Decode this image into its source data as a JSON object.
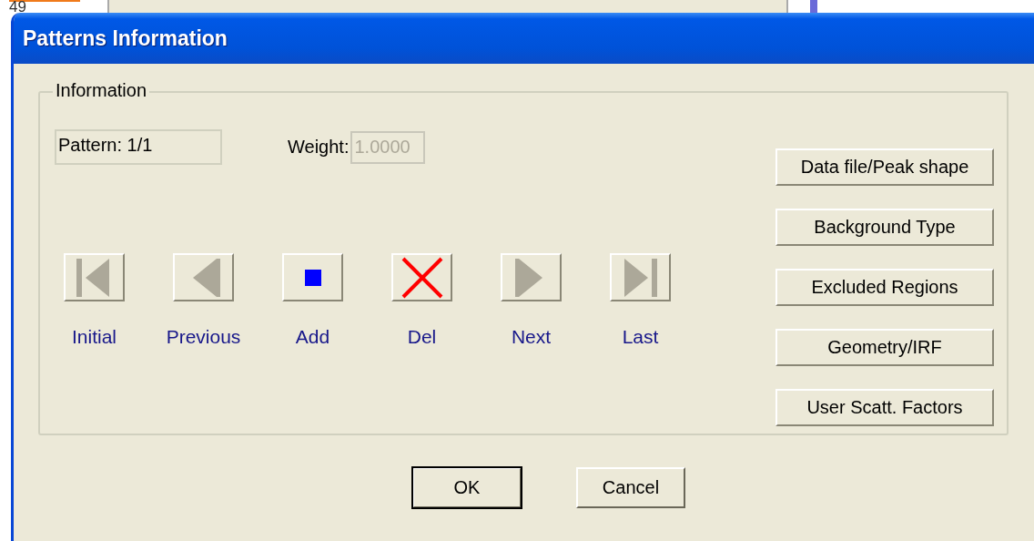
{
  "background": {
    "text": "49"
  },
  "window": {
    "title": "Patterns Information"
  },
  "group": {
    "title": "Information",
    "pattern": {
      "text": "Pattern: 1/1"
    },
    "weight": {
      "label": "Weight:",
      "value": "1.0000",
      "disabled": true
    },
    "nav": [
      {
        "kind": "first",
        "label": "Initial"
      },
      {
        "kind": "prev",
        "label": "Previous"
      },
      {
        "kind": "add",
        "label": "Add"
      },
      {
        "kind": "delete",
        "label": "Del"
      },
      {
        "kind": "next",
        "label": "Next"
      },
      {
        "kind": "last",
        "label": "Last"
      }
    ],
    "side_buttons": [
      "Data file/Peak shape",
      "Background Type",
      "Excluded Regions",
      "Geometry/IRF",
      "User Scatt. Factors"
    ]
  },
  "buttons": [
    {
      "label": "OK",
      "default": true
    },
    {
      "label": "Cancel",
      "default": false
    }
  ]
}
